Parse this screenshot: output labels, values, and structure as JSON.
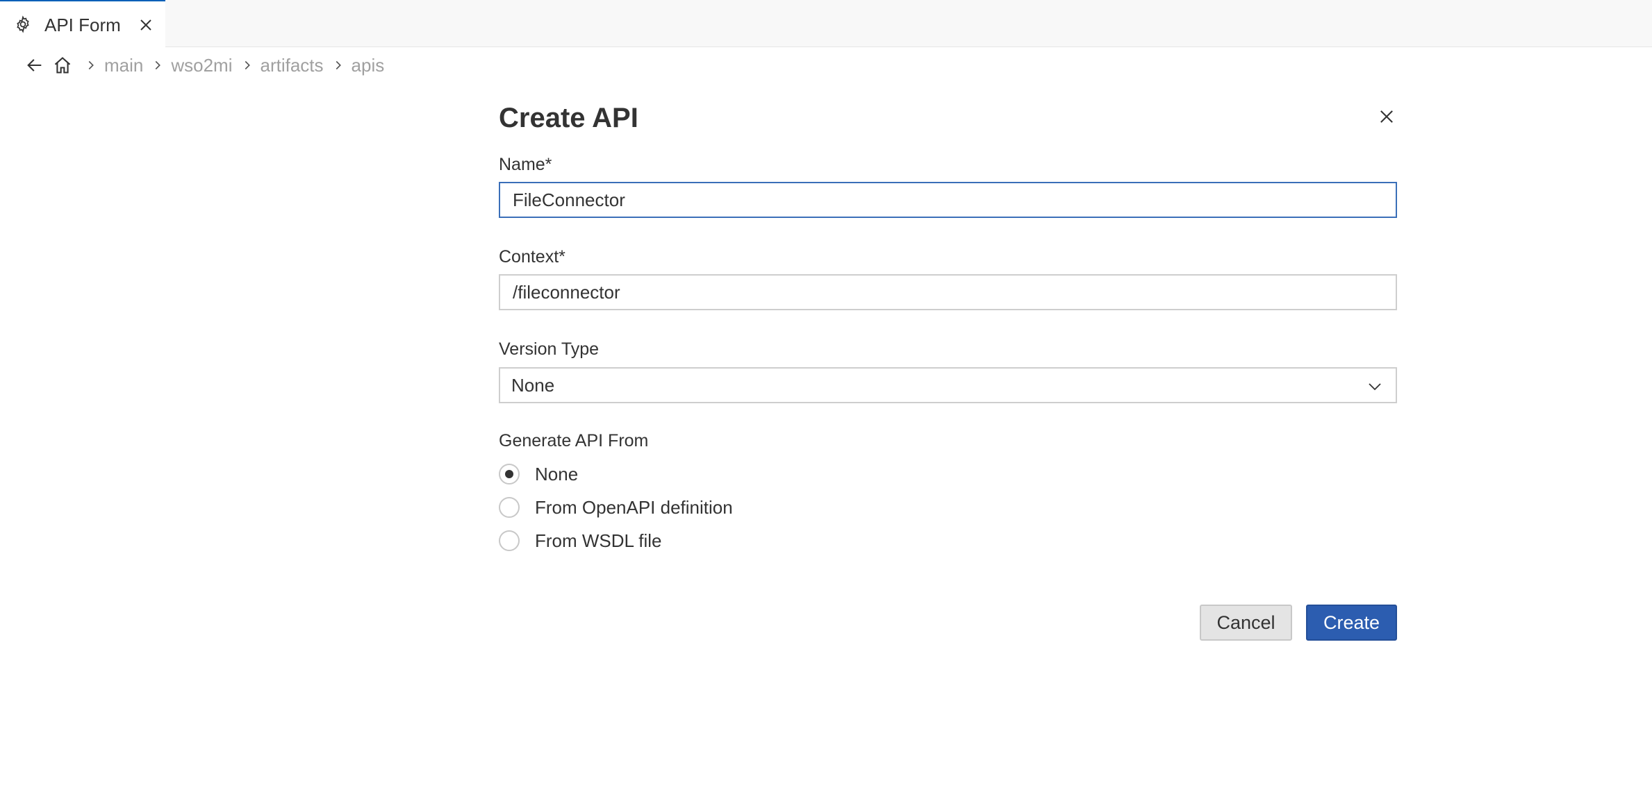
{
  "tab": {
    "icon": "gear-icon",
    "label": "API Form",
    "close_icon": "close-icon"
  },
  "breadcrumb": {
    "items": [
      "main",
      "wso2mi",
      "artifacts",
      "apis"
    ]
  },
  "form": {
    "title": "Create API",
    "name": {
      "label": "Name*",
      "value": "FileConnector"
    },
    "context": {
      "label": "Context*",
      "value": "/fileconnector"
    },
    "version_type": {
      "label": "Version Type",
      "selected": "None"
    },
    "generate_from": {
      "label": "Generate API From",
      "options": [
        {
          "label": "None",
          "checked": true
        },
        {
          "label": "From OpenAPI definition",
          "checked": false
        },
        {
          "label": "From WSDL file",
          "checked": false
        }
      ]
    },
    "buttons": {
      "cancel": "Cancel",
      "create": "Create"
    }
  },
  "colors": {
    "accent": "#2c5db0",
    "focus_border": "#3a6fb8",
    "tab_top_border": "#005fb8"
  }
}
